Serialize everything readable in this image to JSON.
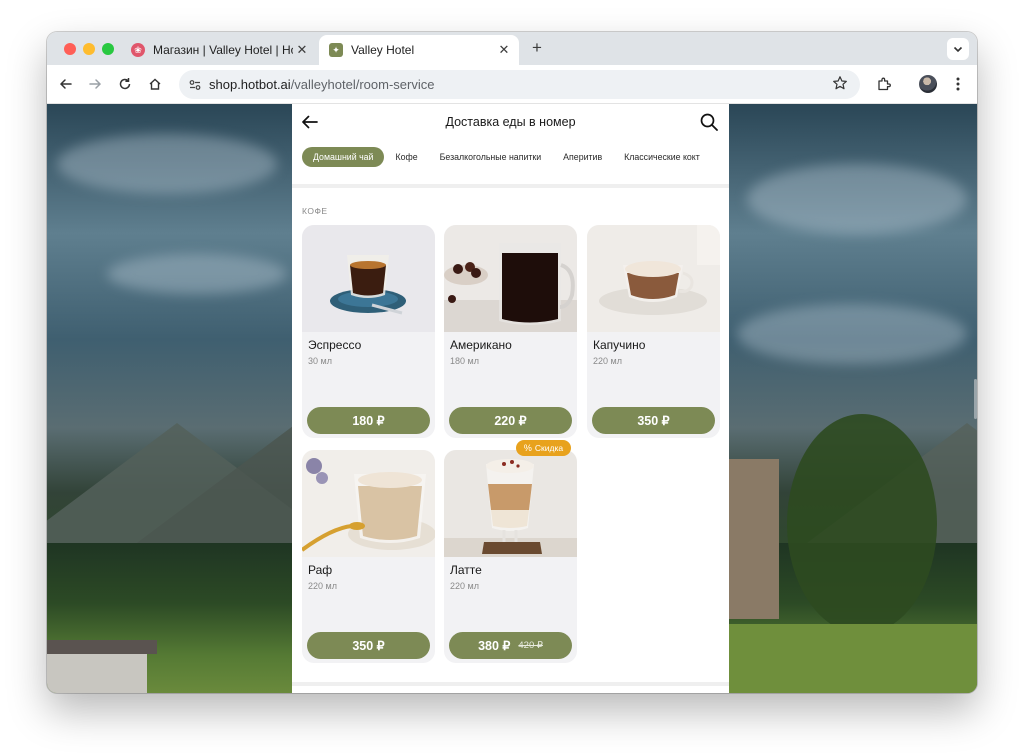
{
  "browser": {
    "tabs": [
      {
        "title": "Магазин | Valley Hotel | Hotb",
        "active": false
      },
      {
        "title": "Valley Hotel",
        "active": true
      }
    ],
    "url_domain": "shop.hotbot.ai",
    "url_path": "/valleyhotel/room-service"
  },
  "app": {
    "title": "Доставка еды в номер",
    "categories": [
      "Домашний чай",
      "Кофе",
      "Безалкогольные напитки",
      "Аперитив",
      "Классические кокт"
    ],
    "active_category": "Домашний чай",
    "section_label": "КОФЕ",
    "items": [
      {
        "name": "Эспрессо",
        "volume": "30 мл",
        "price": "180 ₽"
      },
      {
        "name": "Американо",
        "volume": "180 мл",
        "price": "220 ₽"
      },
      {
        "name": "Капучино",
        "volume": "220 мл",
        "price": "350 ₽"
      },
      {
        "name": "Раф",
        "volume": "220 мл",
        "price": "350 ₽"
      },
      {
        "name": "Латте",
        "volume": "220 мл",
        "price": "380 ₽",
        "old_price": "420 ₽",
        "badge": "Скидка"
      }
    ]
  },
  "colors": {
    "accent": "#7d8a55",
    "badge": "#e8a21d",
    "card_bg": "#f2f2f4"
  }
}
